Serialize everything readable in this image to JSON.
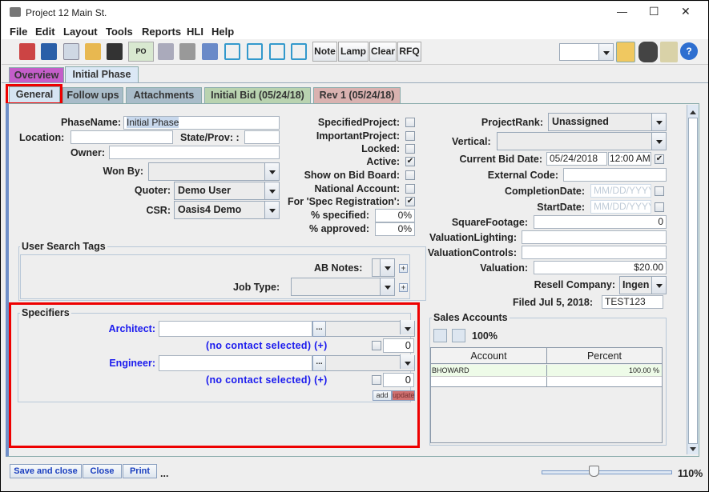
{
  "window": {
    "title": "Project 12 Main St.",
    "minimize": "—",
    "maximize": "☐",
    "close": "✕"
  },
  "menu": [
    "File",
    "Edit",
    "Layout",
    "Tools",
    "Reports",
    "HLI",
    "Help"
  ],
  "toolbar": {
    "icons": [
      "home-icon",
      "save-icon",
      "copy-icon",
      "paste-icon",
      "print-icon",
      "po-icon",
      "filter-icon",
      "keyboard-icon",
      "chart-cost-icon",
      "move-left-icon",
      "move-right-icon",
      "move-up-icon",
      "move-down-icon"
    ],
    "po_label": "PO",
    "buttons": [
      "Note",
      "Lamp",
      "Clear",
      "RFQ"
    ],
    "right_combo": ""
  },
  "tabs_top": [
    {
      "label": "Overview",
      "color": "#c45ec9"
    },
    {
      "label": "Initial Phase",
      "color": "#dbe8f5"
    }
  ],
  "tabs_sub": [
    {
      "label": "General",
      "color": "#d6e4f2"
    },
    {
      "label": "Follow ups",
      "color": "#a9bcc9"
    },
    {
      "label": "Attachments",
      "color": "#a9bcc9"
    },
    {
      "label": "Initial Bid (05/24/18)",
      "color": "#b9d3b0"
    },
    {
      "label": "Rev 1 (05/24/18)",
      "color": "#d9b2b0"
    }
  ],
  "form": {
    "phase_name": {
      "label": "PhaseName:",
      "value": "Initial Phase"
    },
    "location": {
      "label": "Location:",
      "value": ""
    },
    "state": {
      "label": "State/Prov: :",
      "value": ""
    },
    "owner": {
      "label": "Owner:",
      "value": ""
    },
    "won_by": {
      "label": "Won By:",
      "value": ""
    },
    "quoter": {
      "label": "Quoter:",
      "value": "Demo User"
    },
    "csr": {
      "label": "CSR:",
      "value": "Oasis4 Demo"
    },
    "flags": [
      {
        "label": "SpecifiedProject:",
        "checked": false
      },
      {
        "label": "ImportantProject:",
        "checked": false
      },
      {
        "label": "Locked:",
        "checked": false
      },
      {
        "label": "Active:",
        "checked": true
      },
      {
        "label": "Show on Bid Board:",
        "checked": false
      },
      {
        "label": "National Account:",
        "checked": false
      },
      {
        "label": "For 'Spec Registration':",
        "checked": true
      }
    ],
    "pct_specified": {
      "label": "% specified:",
      "value": "0%"
    },
    "pct_approved": {
      "label": "% approved:",
      "value": "0%"
    },
    "project_rank": {
      "label": "ProjectRank:",
      "value": "Unassigned"
    },
    "vertical": {
      "label": "Vertical:",
      "value": ""
    },
    "current_bid_date": {
      "label": "Current Bid Date:",
      "date": "05/24/2018",
      "time": "12:00 AM",
      "checked": true
    },
    "external_code": {
      "label": "External Code:",
      "value": ""
    },
    "completion_date": {
      "label": "CompletionDate:",
      "placeholder": "MM/DD/YYYY"
    },
    "start_date": {
      "label": "StartDate:",
      "placeholder": "MM/DD/YYYY"
    },
    "square_footage": {
      "label": "SquareFootage:",
      "value": "0"
    },
    "valuation_lighting": {
      "label": "ValuationLighting:",
      "value": ""
    },
    "valuation_controls": {
      "label": "ValuationControls:",
      "value": ""
    },
    "valuation": {
      "label": "Valuation:",
      "value": "$20.00"
    },
    "resell_company": {
      "label": "Resell Company:",
      "value": "Ingen"
    },
    "filed": {
      "label": "Filed Jul 5, 2018:",
      "value": "TEST123"
    }
  },
  "search_tags": {
    "title": "User Search Tags",
    "ab_notes": "AB Notes:",
    "job_type": "Job Type:",
    "plus": "+"
  },
  "specifiers": {
    "title": "Specifiers",
    "rows": [
      {
        "label": "Architect:",
        "contact": "(no contact selected) (+)",
        "count": "0"
      },
      {
        "label": "Engineer:",
        "contact": "(no contact selected) (+)",
        "count": "0"
      }
    ],
    "ellipsis": "...",
    "add": "add",
    "update": "update"
  },
  "sales_accounts": {
    "title": "Sales Accounts",
    "total": "100%",
    "columns": [
      "Account",
      "Percent"
    ],
    "rows": [
      {
        "account": "BHOWARD",
        "percent": "100.00 %"
      }
    ]
  },
  "footer": {
    "save_close": "Save and close",
    "close": "Close",
    "print": "Print",
    "more": "...",
    "zoom": "110%",
    "zoom_value": 110
  }
}
